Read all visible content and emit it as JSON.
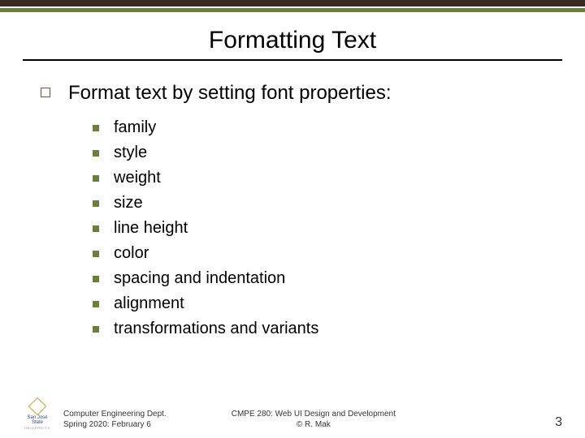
{
  "title": "Formatting Text",
  "main_bullet": "Format text by setting font properties:",
  "items": [
    "family",
    "style",
    "weight",
    "size",
    "line height",
    "color",
    "spacing and indentation",
    "alignment",
    "transformations and variants"
  ],
  "footer": {
    "logo_top": "San José State",
    "logo_sub": "UNIVERSITY",
    "dept_line1": "Computer Engineering Dept.",
    "dept_line2": "Spring 2020: February 6",
    "course_line1": "CMPE 280: Web UI Design and Development",
    "course_line2": "© R. Mak",
    "page": "3"
  }
}
